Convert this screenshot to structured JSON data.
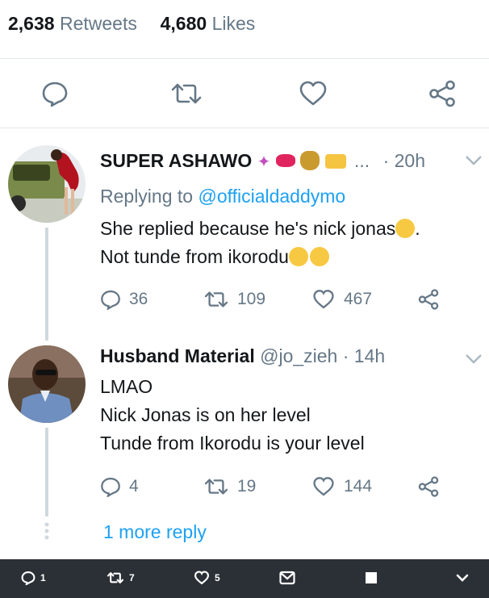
{
  "stats": {
    "retweets_count": "2,638",
    "retweets_label": "Retweets",
    "likes_count": "4,680",
    "likes_label": "Likes"
  },
  "main_actions": [
    "reply-icon",
    "retweet-icon",
    "like-icon",
    "share-icon"
  ],
  "replies": [
    {
      "name": "SUPER ASHAWO",
      "name_extras": "...",
      "time": "· 20h",
      "replying_prefix": "Replying to",
      "replying_to": "@officialdaddymo",
      "lines": [
        "She replied because he's nick jonas",
        ".",
        "Not tunde from ikorodu"
      ],
      "reply_count": "36",
      "retweet_count": "109",
      "like_count": "467"
    },
    {
      "name": "Husband Material",
      "handle": "@jo_zieh",
      "time": "· 14h",
      "lines": [
        "LMAO",
        "Nick Jonas is on her level",
        "Tunde from Ikorodu is your level"
      ],
      "reply_count": "4",
      "retweet_count": "19",
      "like_count": "144"
    }
  ],
  "more_reply": "1 more reply",
  "bottom_bar": {
    "reply_count": "1",
    "retweet_count": "7",
    "like_count": "5"
  },
  "colors": {
    "accent": "#1da1f2",
    "muted": "#657786",
    "text": "#14171a",
    "bar": "#2b3036"
  }
}
